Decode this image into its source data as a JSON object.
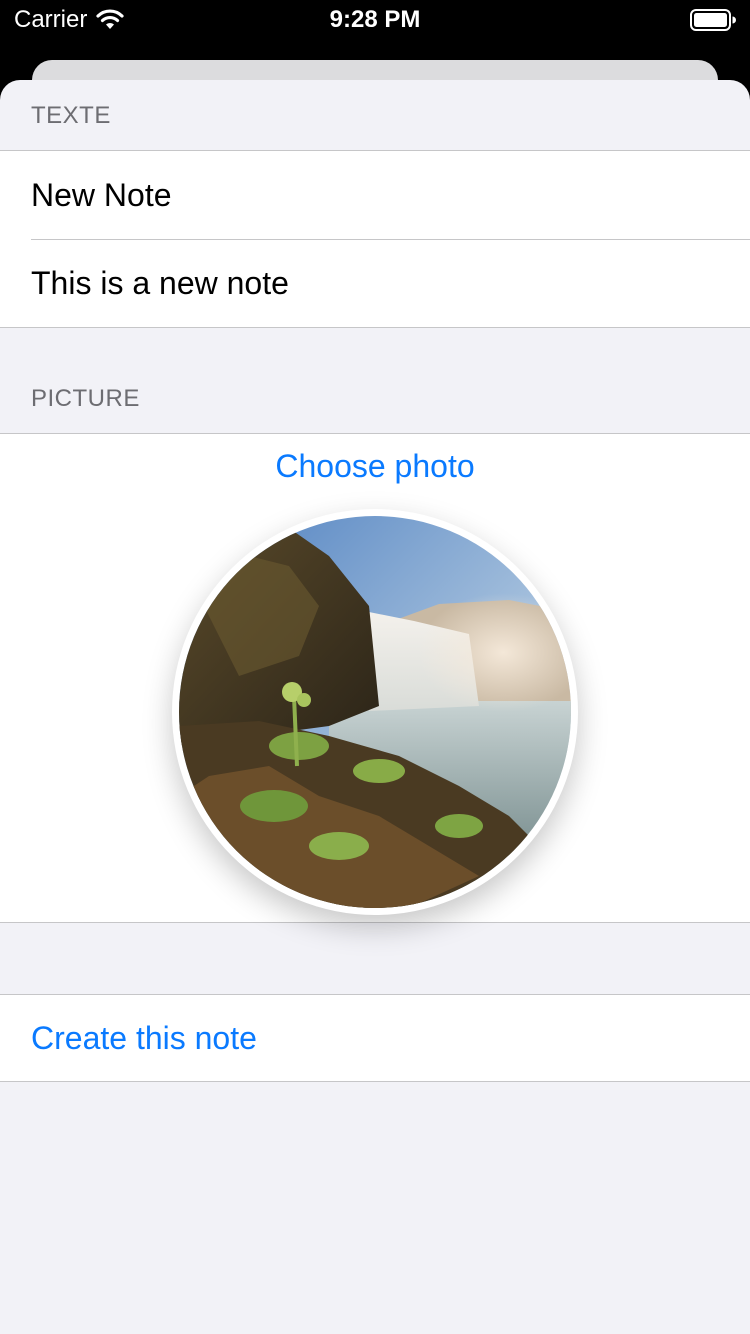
{
  "status_bar": {
    "carrier": "Carrier",
    "time": "9:28 PM",
    "wifi_icon": "wifi-icon",
    "battery_icon": "battery-full-icon"
  },
  "form": {
    "text_section": {
      "header": "TEXTE",
      "title_value": "New Note",
      "body_value": "This is a new note"
    },
    "picture_section": {
      "header": "PICTURE",
      "choose_photo_label": "Choose photo",
      "photo_subject": "waterfall landscape"
    },
    "action_section": {
      "create_label": "Create this note"
    }
  },
  "colors": {
    "accent": "#0a7aff",
    "grouped_background": "#f2f2f7",
    "separator": "#c6c6c8",
    "header_text": "#6d6d72"
  }
}
